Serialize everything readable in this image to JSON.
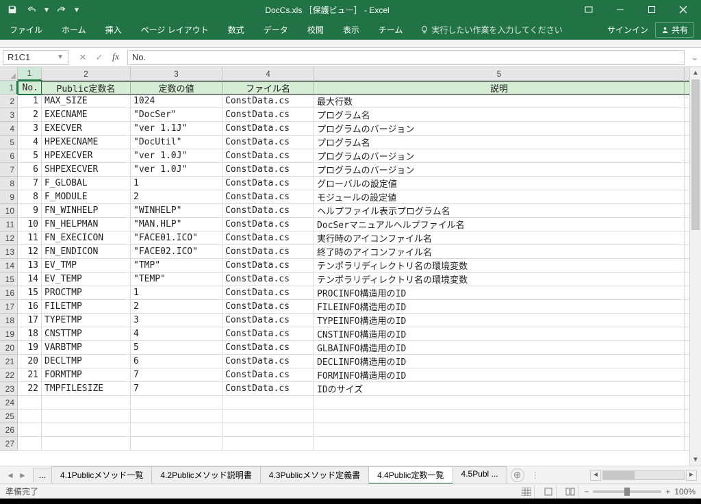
{
  "window": {
    "title": "DocCs.xls ［保護ビュー］ - Excel",
    "signin": "サインイン",
    "share": "共有"
  },
  "qat": {
    "save": "save",
    "undo": "undo",
    "redo": "redo"
  },
  "ribbon": {
    "tabs": [
      "ファイル",
      "ホーム",
      "挿入",
      "ページ レイアウト",
      "数式",
      "データ",
      "校閲",
      "表示",
      "チーム"
    ],
    "tellme": "実行したい作業を入力してください"
  },
  "formula": {
    "namebox": "R1C1",
    "value": "No."
  },
  "columns": [
    "1",
    "2",
    "3",
    "4",
    "5"
  ],
  "headers": {
    "c1": "No.",
    "c2": "Public定数名",
    "c3": "定数の値",
    "c4": "ファイル名",
    "c5": "説明"
  },
  "rows": [
    {
      "n": "1",
      "name": "MAX_SIZE",
      "val": "1024",
      "file": "ConstData.cs",
      "desc": "最大行数"
    },
    {
      "n": "2",
      "name": "EXECNAME",
      "val": "\"DocSer\"",
      "file": "ConstData.cs",
      "desc": "プログラム名"
    },
    {
      "n": "3",
      "name": "EXECVER",
      "val": "\"ver 1.1J\"",
      "file": "ConstData.cs",
      "desc": "プログラムのバージョン"
    },
    {
      "n": "4",
      "name": "HPEXECNAME",
      "val": "\"DocUtil\"",
      "file": "ConstData.cs",
      "desc": "プログラム名"
    },
    {
      "n": "5",
      "name": "HPEXECVER",
      "val": "\"ver 1.0J\"",
      "file": "ConstData.cs",
      "desc": "プログラムのバージョン"
    },
    {
      "n": "6",
      "name": "SHPEXECVER",
      "val": "\"ver 1.0J\"",
      "file": "ConstData.cs",
      "desc": "プログラムのバージョン"
    },
    {
      "n": "7",
      "name": "F_GLOBAL",
      "val": "1",
      "file": "ConstData.cs",
      "desc": "グローバルの設定値"
    },
    {
      "n": "8",
      "name": "F_MODULE",
      "val": "2",
      "file": "ConstData.cs",
      "desc": "モジュールの設定値"
    },
    {
      "n": "9",
      "name": "FN_WINHELP",
      "val": "\"WINHELP\"",
      "file": "ConstData.cs",
      "desc": "ヘルプファイル表示プログラム名"
    },
    {
      "n": "10",
      "name": "FN_HELPMAN",
      "val": "\"MAN.HLP\"",
      "file": "ConstData.cs",
      "desc": "DocSerマニュアルヘルプファイル名"
    },
    {
      "n": "11",
      "name": "FN_EXECICON",
      "val": "\"FACE01.ICO\"",
      "file": "ConstData.cs",
      "desc": "実行時のアイコンファイル名"
    },
    {
      "n": "12",
      "name": "FN_ENDICON",
      "val": "\"FACE02.ICO\"",
      "file": "ConstData.cs",
      "desc": "終了時のアイコンファイル名"
    },
    {
      "n": "13",
      "name": "EV_TMP",
      "val": "\"TMP\"",
      "file": "ConstData.cs",
      "desc": "テンポラリディレクトリ名の環境変数"
    },
    {
      "n": "14",
      "name": "EV_TEMP",
      "val": "\"TEMP\"",
      "file": "ConstData.cs",
      "desc": "テンポラリディレクトリ名の環境変数"
    },
    {
      "n": "15",
      "name": "PROCTMP",
      "val": "1",
      "file": "ConstData.cs",
      "desc": "PROCINFO構造用のID"
    },
    {
      "n": "16",
      "name": "FILETMP",
      "val": "2",
      "file": "ConstData.cs",
      "desc": "FILEINFO構造用のID"
    },
    {
      "n": "17",
      "name": "TYPETMP",
      "val": "3",
      "file": "ConstData.cs",
      "desc": "TYPEINFO構造用のID"
    },
    {
      "n": "18",
      "name": "CNSTTMP",
      "val": "4",
      "file": "ConstData.cs",
      "desc": "CNSTINFO構造用のID"
    },
    {
      "n": "19",
      "name": "VARBTMP",
      "val": "5",
      "file": "ConstData.cs",
      "desc": "GLBAINFO構造用のID"
    },
    {
      "n": "20",
      "name": "DECLTMP",
      "val": "6",
      "file": "ConstData.cs",
      "desc": "DECLINFO構造用のID"
    },
    {
      "n": "21",
      "name": "FORMTMP",
      "val": "7",
      "file": "ConstData.cs",
      "desc": "FORMINFO構造用のID"
    },
    {
      "n": "22",
      "name": "TMPFILESIZE",
      "val": "7",
      "file": "ConstData.cs",
      "desc": "IDのサイズ"
    }
  ],
  "emptyRows": [
    24,
    25,
    26,
    27
  ],
  "sheets": {
    "ellipsis": "...",
    "tabs": [
      "4.1Publicメソッド一覧",
      "4.2Publicメソッド説明書",
      "4.3Publicメソッド定義書",
      "4.4Public定数一覧",
      "4.5Publ ..."
    ],
    "activeIndex": 3
  },
  "status": {
    "ready": "準備完了",
    "zoom": "100%"
  }
}
